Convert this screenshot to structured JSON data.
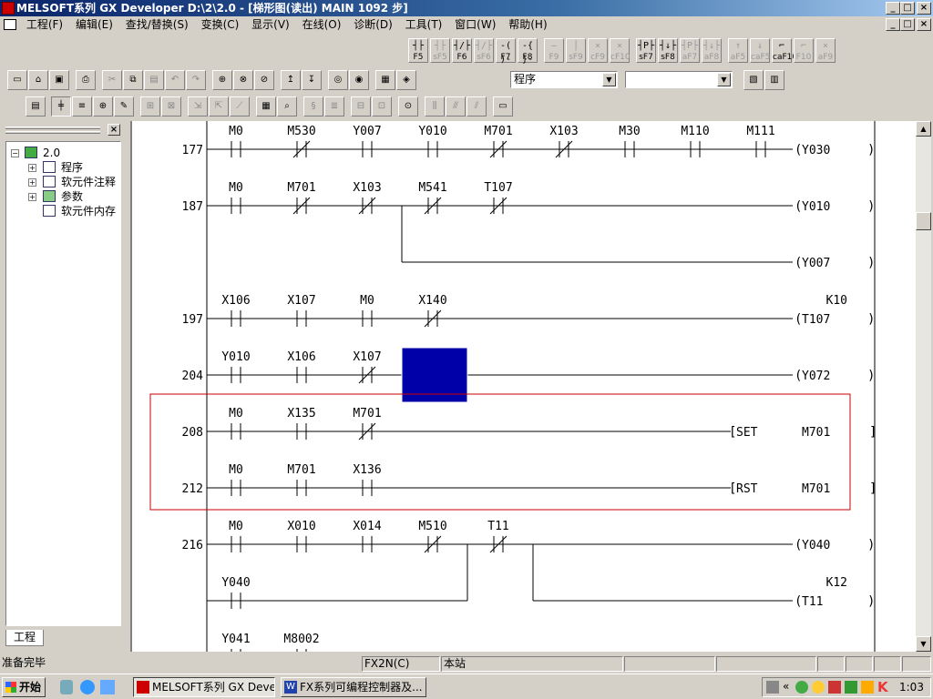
{
  "window": {
    "title": "MELSOFT系列 GX Developer D:\\2\\2.0 - [梯形图(读出)   MAIN   1092 步]"
  },
  "menu": [
    "工程(F)",
    "编辑(E)",
    "查找/替换(S)",
    "变换(C)",
    "显示(V)",
    "在线(O)",
    "诊断(D)",
    "工具(T)",
    "窗口(W)",
    "帮助(H)"
  ],
  "fkeys": [
    {
      "label": "F5",
      "enabled": true
    },
    {
      "label": "sF5",
      "enabled": false
    },
    {
      "label": "F6",
      "enabled": true
    },
    {
      "label": "sF6",
      "enabled": false
    },
    {
      "label": "F7",
      "enabled": true
    },
    {
      "label": "F8",
      "enabled": true
    },
    {
      "label": "F9",
      "enabled": false
    },
    {
      "label": "sF9",
      "enabled": false
    },
    {
      "label": "cF9",
      "enabled": false
    },
    {
      "label": "cF10",
      "enabled": false
    },
    {
      "label": "sF7",
      "enabled": true
    },
    {
      "label": "sF8",
      "enabled": true
    },
    {
      "label": "aF7",
      "enabled": false
    },
    {
      "label": "aF8",
      "enabled": false
    },
    {
      "label": "aF5",
      "enabled": false
    },
    {
      "label": "caF5",
      "enabled": false
    },
    {
      "label": "caF10",
      "enabled": true
    },
    {
      "label": "F10",
      "enabled": false
    },
    {
      "label": "aF9",
      "enabled": false
    }
  ],
  "combo_program": "程序",
  "combo_second": "",
  "panel": {
    "close": "×",
    "tree": [
      {
        "label": "2.0",
        "level": 0
      },
      {
        "label": "程序",
        "level": 1
      },
      {
        "label": "软元件注释",
        "level": 1
      },
      {
        "label": "参数",
        "level": 1
      },
      {
        "label": "软元件内存",
        "level": 1
      }
    ],
    "tab": "工程"
  },
  "ladder": {
    "rungs": [
      {
        "step": "177",
        "contacts": [
          [
            "M0",
            "NO"
          ],
          [
            "M530",
            "NC"
          ],
          [
            "Y007",
            "NO"
          ],
          [
            "Y010",
            "NO"
          ],
          [
            "M701",
            "NC"
          ],
          [
            "X103",
            "NC"
          ],
          [
            "M30",
            "NO"
          ],
          [
            "M110",
            "NO"
          ],
          [
            "M111",
            "NO"
          ]
        ],
        "coil": "Y030"
      },
      {
        "step": "187",
        "contacts": [
          [
            "M0",
            "NO"
          ],
          [
            "M701",
            "NC"
          ],
          [
            "X103",
            "NC"
          ],
          [
            "M541",
            "NC"
          ],
          [
            "T107",
            "NC"
          ]
        ],
        "coil": "Y010",
        "branch_coil": "Y007"
      },
      {
        "step": "197",
        "contacts": [
          [
            "X106",
            "NO"
          ],
          [
            "X107",
            "NO"
          ],
          [
            "M0",
            "NO"
          ],
          [
            "X140",
            "NC"
          ]
        ],
        "coil": "T107",
        "coil_const": "K10"
      },
      {
        "step": "204",
        "contacts": [
          [
            "Y010",
            "NO"
          ],
          [
            "X106",
            "NO"
          ],
          [
            "X107",
            "NC"
          ]
        ],
        "coil": "Y072"
      },
      {
        "step": "208",
        "contacts": [
          [
            "M0",
            "NO"
          ],
          [
            "X135",
            "NO"
          ],
          [
            "M701",
            "NC"
          ]
        ],
        "instr": "SET",
        "operand": "M701"
      },
      {
        "step": "212",
        "contacts": [
          [
            "M0",
            "NO"
          ],
          [
            "M701",
            "NO"
          ],
          [
            "X136",
            "NO"
          ]
        ],
        "instr": "RST",
        "operand": "M701"
      },
      {
        "step": "216",
        "contacts": [
          [
            "M0",
            "NO"
          ],
          [
            "X010",
            "NO"
          ],
          [
            "X014",
            "NO"
          ],
          [
            "M510",
            "NC"
          ],
          [
            "T11",
            "NC"
          ]
        ],
        "coil": "Y040",
        "branch_contact": "Y040",
        "branch_coil": "T11",
        "branch_const": "K12"
      },
      {
        "step": "",
        "contacts": [
          [
            "Y041",
            "P"
          ],
          [
            "M8002",
            "NO"
          ]
        ]
      }
    ]
  },
  "status": {
    "ready": "准备完毕",
    "plc": "FX2N(C)",
    "station": "本站"
  },
  "taskbar": {
    "start": "开始",
    "tasks": [
      "MELSOFT系列 GX Devel...",
      "FX系列可编程控制器及..."
    ],
    "clock": "1:03"
  }
}
